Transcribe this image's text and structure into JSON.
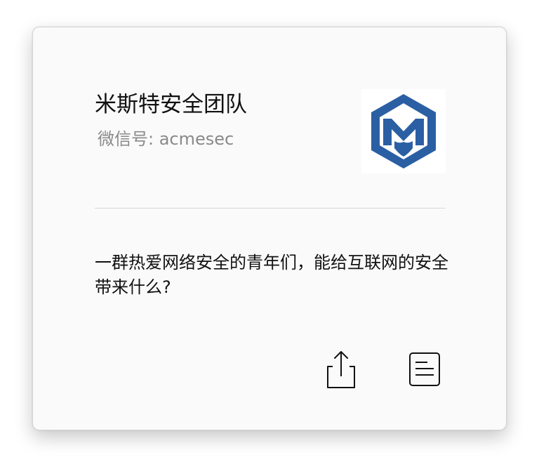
{
  "account": {
    "name": "米斯特安全团队",
    "wechat_id": "微信号: acmesec",
    "description": "一群热爱网络安全的青年们，能给互联网的安全带来什么?"
  },
  "logo": {
    "icon": "hexagon-m-shield-logo",
    "color": "#2b5fa3"
  },
  "actions": {
    "share_icon": "share-icon",
    "detail_icon": "document-icon"
  }
}
